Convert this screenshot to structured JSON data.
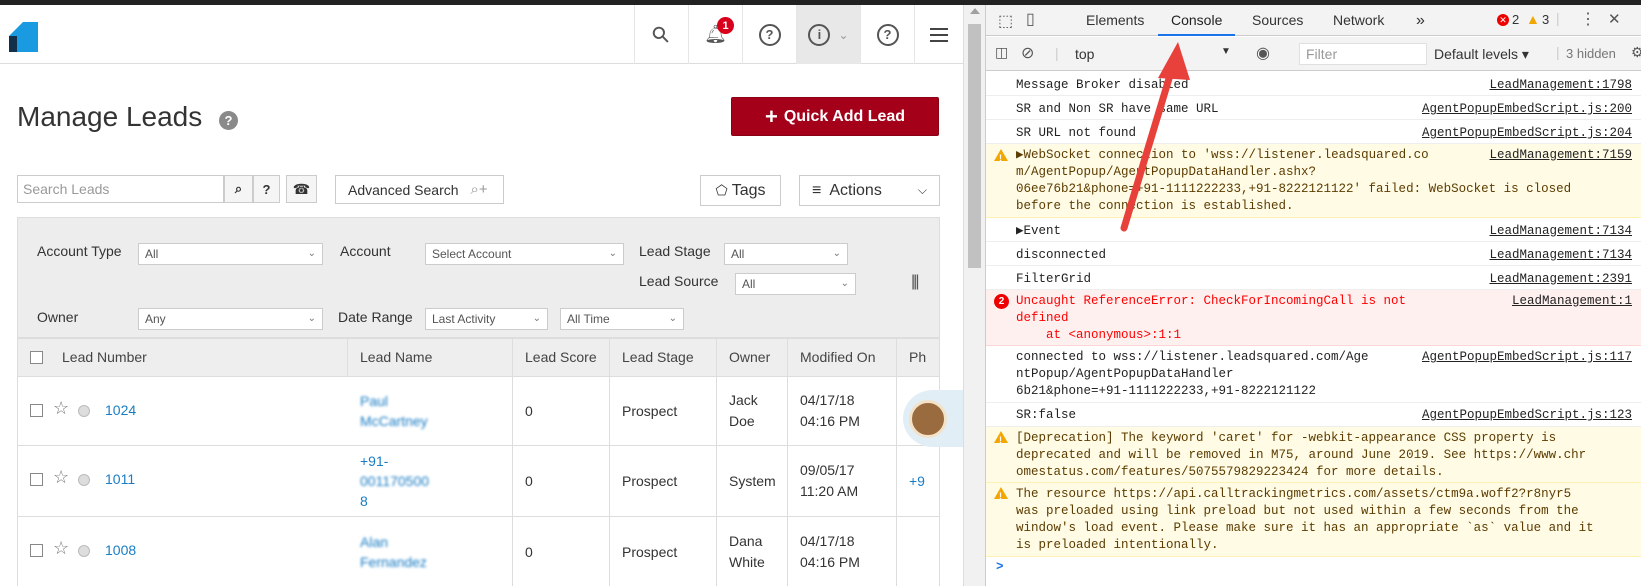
{
  "app": {
    "page_title": "Manage Leads",
    "help_glyph": "?",
    "bell_badge": "1",
    "nav_glyphs": {
      "search": "⚲",
      "help": "?",
      "profile": "i",
      "profile_caret": "⌄",
      "help2": "?"
    },
    "quick_add": {
      "plus": "+",
      "label": "Quick Add Lead"
    },
    "search": {
      "placeholder": "Search Leads",
      "help_glyph": "?"
    },
    "advanced_search": "Advanced Search",
    "tags": "Tags",
    "actions": "Actions",
    "filters": {
      "account_type": {
        "label": "Account Type",
        "value": "All"
      },
      "account": {
        "label": "Account",
        "value": "Select Account"
      },
      "lead_stage": {
        "label": "Lead Stage",
        "value": "All"
      },
      "lead_source": {
        "label": "Lead Source",
        "value": "All"
      },
      "owner": {
        "label": "Owner",
        "value": "Any"
      },
      "date_range": {
        "label": "Date Range",
        "value": "Last Activity",
        "period": "All Time"
      }
    },
    "columns": [
      "Lead Number",
      "Lead Name",
      "Lead Score",
      "Lead Stage",
      "Owner",
      "Modified On",
      "Ph"
    ],
    "rows": [
      {
        "number": "1024",
        "name": [
          "Paul",
          "McCartney"
        ],
        "score": "0",
        "stage": "Prospect",
        "owner": [
          "Jack",
          "Doe"
        ],
        "modified": [
          "04/17/18",
          "04:16 PM"
        ],
        "phone": ""
      },
      {
        "number": "1011",
        "name": [
          "+91-",
          "001170500",
          "8"
        ],
        "score": "0",
        "stage": "Prospect",
        "owner": [
          "System"
        ],
        "modified": [
          "09/05/17",
          "11:20 AM"
        ],
        "phone": "+9"
      },
      {
        "number": "1008",
        "name": [
          "Alan",
          "Fernandez"
        ],
        "score": "0",
        "stage": "Prospect",
        "owner": [
          "Dana",
          "White"
        ],
        "modified": [
          "04/17/18",
          "04:16 PM"
        ],
        "phone": ""
      }
    ]
  },
  "devtools": {
    "tabs": [
      "Elements",
      "Console",
      "Sources",
      "Network",
      "»"
    ],
    "active_tab": "Console",
    "error_count": "2",
    "warning_count": "3",
    "context": "top",
    "filter_placeholder": "Filter",
    "levels": "Default levels ▾",
    "hidden": "3 hidden",
    "messages": [
      {
        "type": "log",
        "text": "Message Broker disabled",
        "source": "LeadManagement:1798"
      },
      {
        "type": "log",
        "text": "SR and Non SR have same URL",
        "source": "AgentPopupEmbedScript.js:200"
      },
      {
        "type": "log",
        "text": "SR URL not found",
        "source": "AgentPopupEmbedScript.js:204"
      },
      {
        "type": "warn",
        "text": "▶WebSocket connection to 'wss://listener.leadsquared.co\nm/AgentPopup/AgentPopupDataHandler.ashx?\n06ee76b21&phone=+91-1111222233,+91-8222121122' failed: WebSocket is closed\nbefore the connection is established.",
        "source": "LeadManagement:7159"
      },
      {
        "type": "log",
        "text": "▶Event",
        "source": "LeadManagement:7134"
      },
      {
        "type": "log",
        "text": "disconnected",
        "source": "LeadManagement:7134"
      },
      {
        "type": "log",
        "text": "FilterGrid",
        "source": "LeadManagement:2391"
      },
      {
        "type": "err",
        "badge": "2",
        "text": "Uncaught ReferenceError: CheckForIncomingCall is not\ndefined\n    at <anonymous>:1:1",
        "source": "LeadManagement:1"
      },
      {
        "type": "log",
        "text": "connected to wss://listener.leadsquared.com/Age\nntPopup/AgentPopupDataHandler\n6b21&phone=+91-1111222233,+91-8222121122",
        "source": "AgentPopupEmbedScript.js:117"
      },
      {
        "type": "log",
        "text": "SR:false",
        "source": "AgentPopupEmbedScript.js:123"
      },
      {
        "type": "warn",
        "text": "[Deprecation] The keyword 'caret' for -webkit-appearance CSS property is\ndeprecated and will be removed in M75, around June 2019. See https://www.chr\nomestatus.com/features/5075579829223424 for more details.",
        "source": ""
      },
      {
        "type": "warn",
        "text": "The resource https://api.calltrackingmetrics.com/assets/ctm9a.woff2?r8nyr5\nwas preloaded using link preload but not used within a few seconds from the\nwindow's load event. Please make sure it has an appropriate `as` value and it\nis preloaded intentionally.",
        "source": ""
      }
    ],
    "prompt": ">"
  },
  "colors": {
    "brand_red": "#a5001a",
    "link_blue": "#1a7dc4",
    "logo_blue": "#1a9ae0",
    "console_tab": "#1a73e8",
    "arrow_red": "#e8413c"
  }
}
